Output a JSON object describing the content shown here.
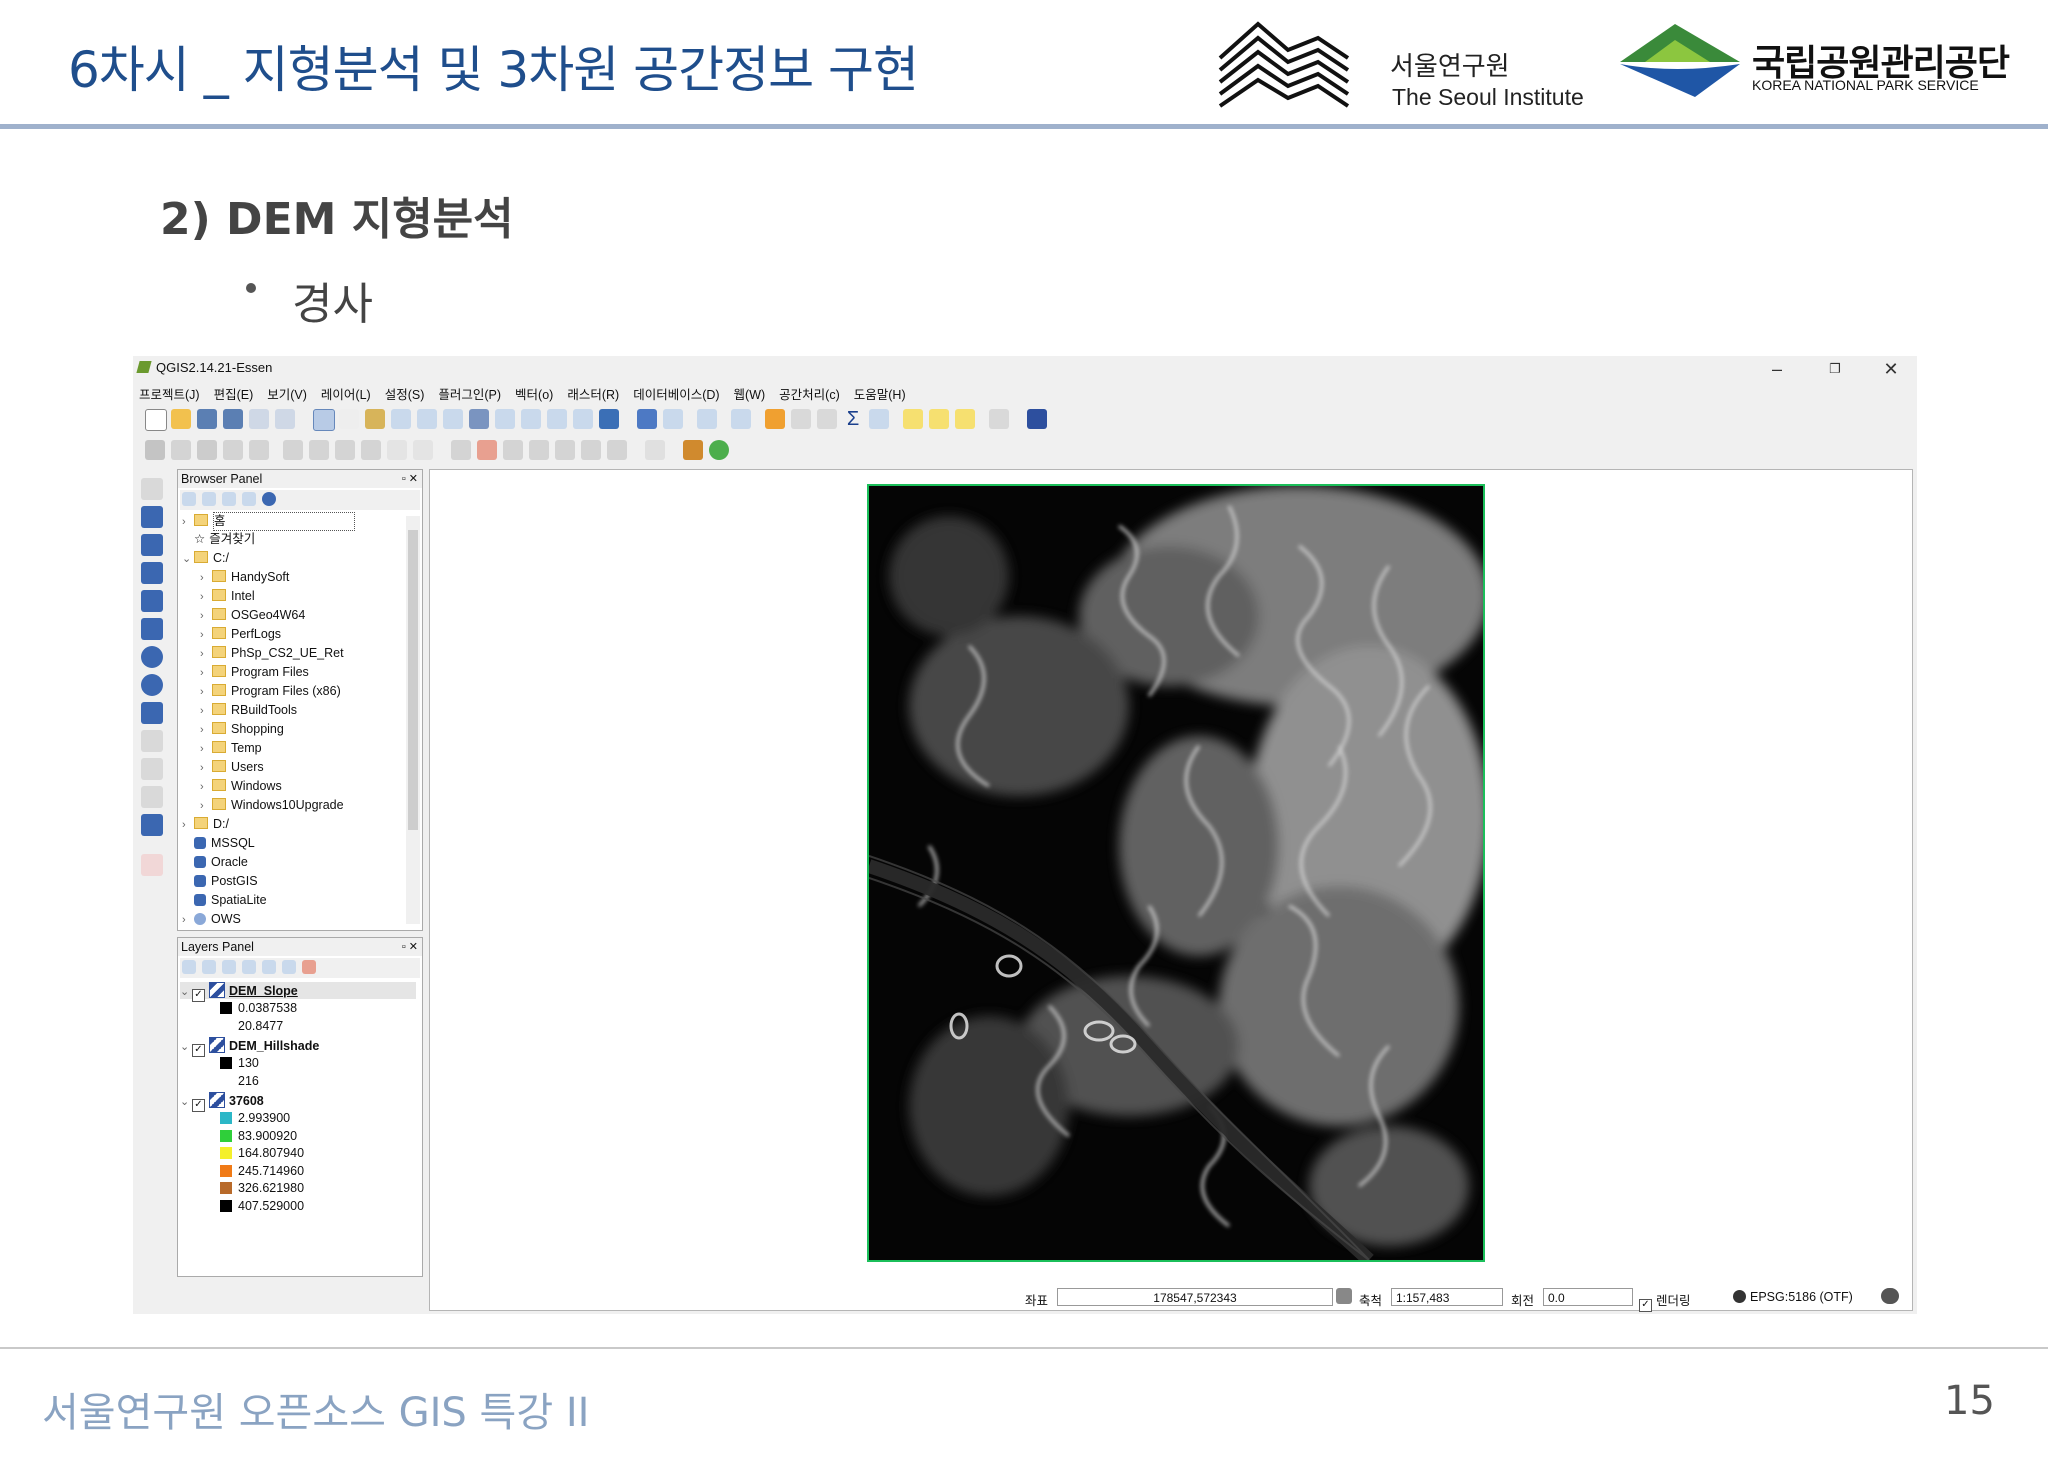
{
  "slide": {
    "title": "6차시 _ 지형분석 및 3차원 공간정보 구현",
    "section": "2) DEM 지형분석",
    "bullet": "경사",
    "footer": "서울연구원 오픈소스 GIS 특강 II",
    "page_number": "15",
    "logo_seoul_ko": "서울연구원",
    "logo_seoul_en": "The Seoul Institute",
    "logo_park_ko": "국립공원관리공단",
    "logo_park_en": "KOREA NATIONAL PARK SERVICE",
    "colors": {
      "title": "#1f4e8c",
      "footer": "#8aa3c2",
      "header_rule": "#9fb1cc"
    }
  },
  "qgis": {
    "window_title": "QGIS2.14.21-Essen",
    "window_controls": [
      "–",
      "❐",
      "✕"
    ],
    "menu": [
      "프로젝트(J)",
      "편집(E)",
      "보기(V)",
      "레이어(L)",
      "설정(S)",
      "플러그인(P)",
      "벡터(o)",
      "래스터(R)",
      "데이터베이스(D)",
      "웹(W)",
      "공간처리(c)",
      "도움말(H)"
    ],
    "browser_panel": {
      "title": "Browser Panel",
      "items": [
        {
          "label": "홈",
          "level": 0,
          "type": "folder",
          "chev": ">"
        },
        {
          "label": "즐겨찾기",
          "level": 0,
          "type": "star",
          "chev": ""
        },
        {
          "label": "C:/",
          "level": 0,
          "type": "folder",
          "chev": "v"
        },
        {
          "label": "HandySoft",
          "level": 1,
          "type": "folder",
          "chev": ">"
        },
        {
          "label": "Intel",
          "level": 1,
          "type": "folder",
          "chev": ">"
        },
        {
          "label": "OSGeo4W64",
          "level": 1,
          "type": "folder",
          "chev": ">"
        },
        {
          "label": "PerfLogs",
          "level": 1,
          "type": "folder",
          "chev": ">"
        },
        {
          "label": "PhSp_CS2_UE_Ret",
          "level": 1,
          "type": "folder",
          "chev": ">"
        },
        {
          "label": "Program Files",
          "level": 1,
          "type": "folder",
          "chev": ">"
        },
        {
          "label": "Program Files (x86)",
          "level": 1,
          "type": "folder",
          "chev": ">"
        },
        {
          "label": "RBuildTools",
          "level": 1,
          "type": "folder",
          "chev": ">"
        },
        {
          "label": "Shopping",
          "level": 1,
          "type": "folder",
          "chev": ">"
        },
        {
          "label": "Temp",
          "level": 1,
          "type": "folder",
          "chev": ">"
        },
        {
          "label": "Users",
          "level": 1,
          "type": "folder",
          "chev": ">"
        },
        {
          "label": "Windows",
          "level": 1,
          "type": "folder",
          "chev": ">"
        },
        {
          "label": "Windows10Upgrade",
          "level": 1,
          "type": "folder",
          "chev": ">"
        },
        {
          "label": "D:/",
          "level": 0,
          "type": "folder",
          "chev": ">"
        },
        {
          "label": "MSSQL",
          "level": 0,
          "type": "mssql",
          "chev": ""
        },
        {
          "label": "Oracle",
          "level": 0,
          "type": "oracle",
          "chev": ""
        },
        {
          "label": "PostGIS",
          "level": 0,
          "type": "postgis",
          "chev": ""
        },
        {
          "label": "SpatiaLite",
          "level": 0,
          "type": "spatialite",
          "chev": ""
        },
        {
          "label": "OWS",
          "level": 0,
          "type": "ows",
          "chev": ">"
        }
      ]
    },
    "layers_panel": {
      "title": "Layers Panel",
      "layers": [
        {
          "name": "DEM_Slope",
          "checked": true,
          "selected": true,
          "legend": [
            {
              "label": "0.0387538",
              "color": "#000000"
            },
            {
              "label": "20.8477",
              "color": ""
            }
          ]
        },
        {
          "name": "DEM_Hillshade",
          "checked": true,
          "selected": false,
          "legend": [
            {
              "label": "130",
              "color": "#000000"
            },
            {
              "label": "216",
              "color": ""
            }
          ]
        },
        {
          "name": "37608",
          "checked": true,
          "selected": false,
          "legend": [
            {
              "label": "2.993900",
              "color": "#2bb7c7"
            },
            {
              "label": "83.900920",
              "color": "#2fcf3a"
            },
            {
              "label": "164.807940",
              "color": "#f4f02a"
            },
            {
              "label": "245.714960",
              "color": "#f07a16"
            },
            {
              "label": "326.621980",
              "color": "#b86a2a"
            },
            {
              "label": "407.529000",
              "color": "#000000"
            }
          ]
        }
      ]
    },
    "status": {
      "coord_label": "좌표",
      "coord_value": "178547,572343",
      "scale_label": "축척",
      "scale_value": "1:157,483",
      "rotation_label": "회전",
      "rotation_value": "0.0",
      "render_label": "렌더링",
      "crs": "EPSG:5186 (OTF)"
    }
  }
}
